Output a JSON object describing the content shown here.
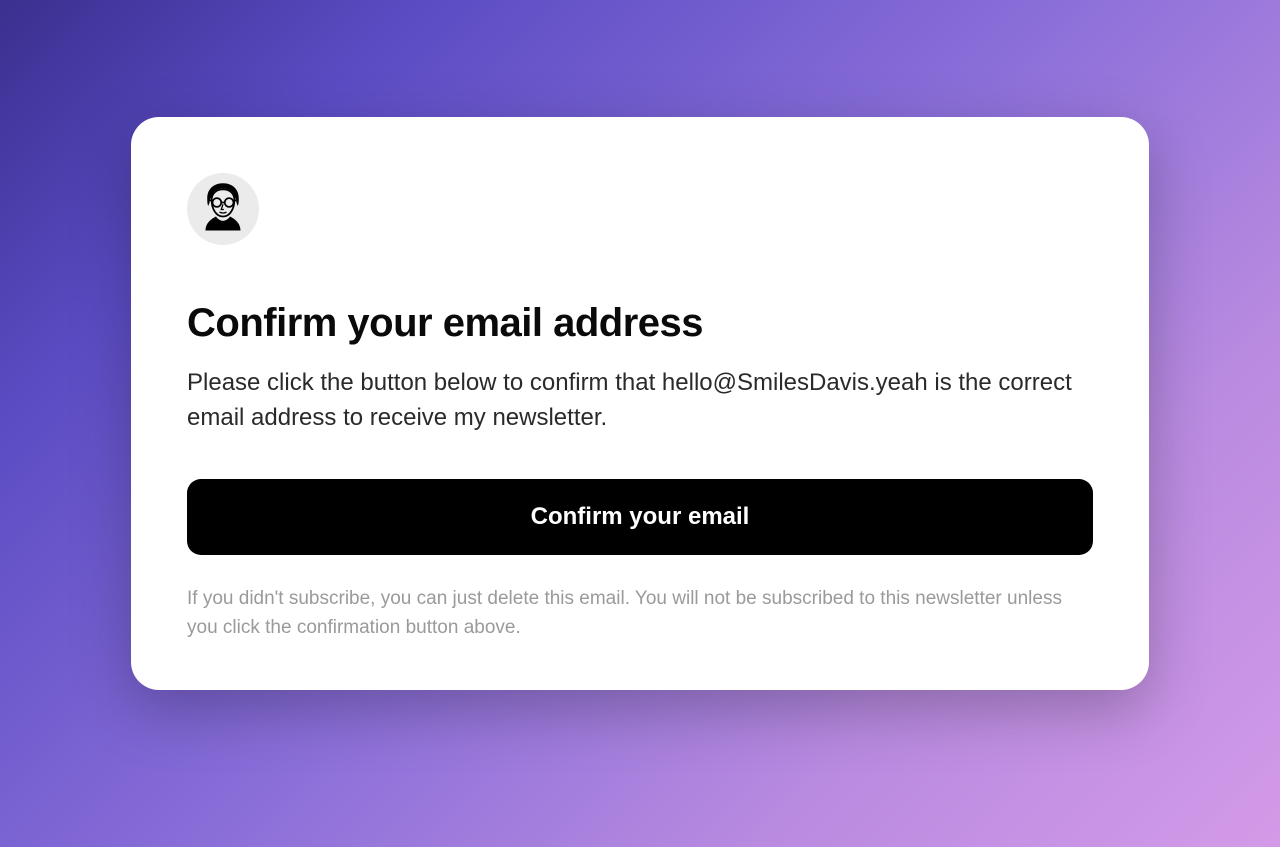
{
  "card": {
    "title": "Confirm your email address",
    "body": "Please click the button below to confirm that hello@SmilesDavis.yeah is the correct email address to receive my newsletter.",
    "button_label": "Confirm your email",
    "footer": "If you didn't subscribe, you can just delete this email. You will not be subscribed to this newsletter unless you click the confirmation button above."
  }
}
